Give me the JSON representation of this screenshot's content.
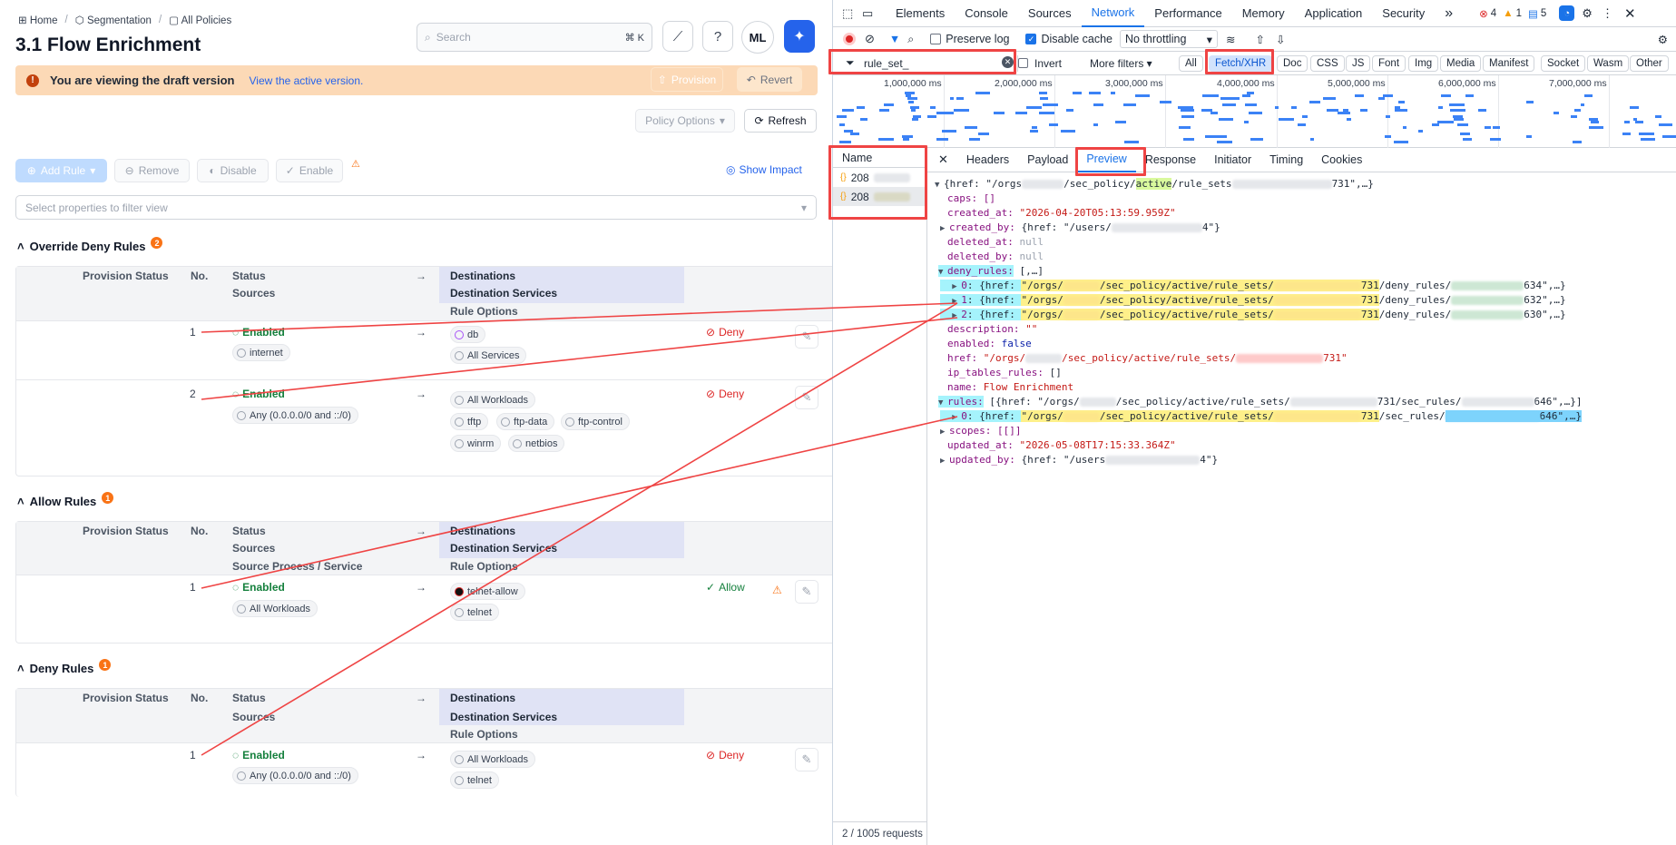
{
  "app": {
    "breadcrumb": {
      "home": "Home",
      "segmentation": "Segmentation",
      "all_policies": "All Policies"
    },
    "title": "3.1 Flow Enrichment",
    "search": {
      "placeholder": "Search",
      "shortcut": "⌘ K"
    },
    "avatar": "ML",
    "banner": {
      "message": "You are viewing the draft version",
      "link": "View the active version."
    },
    "provision_label": "Provision",
    "revert_label": "Revert",
    "policy_options_label": "Policy Options",
    "refresh_label": "Refresh",
    "toolbar": {
      "add_rule": "Add Rule",
      "remove": "Remove",
      "disable": "Disable",
      "enable": "Enable",
      "show_impact": "Show Impact"
    },
    "filter_placeholder": "Select properties to filter view",
    "columns": {
      "provision_status": "Provision Status",
      "no": "No.",
      "status": "Status",
      "sources": "Sources",
      "source_process": "Source Process / Service",
      "destinations": "Destinations",
      "destination_services": "Destination Services",
      "rule_options": "Rule Options",
      "arrow": "→"
    },
    "sections": [
      {
        "title": "Override Deny Rules",
        "count": "2"
      },
      {
        "title": "Allow Rules",
        "count": "1"
      },
      {
        "title": "Deny Rules",
        "count": "1"
      }
    ],
    "override_rows": [
      {
        "no": "1",
        "status": "Enabled",
        "source": "internet",
        "destination": "db",
        "service": "All Services",
        "action": "Deny"
      },
      {
        "no": "2",
        "status": "Enabled",
        "source": "Any (0.0.0.0/0 and ::/0)",
        "destination": "All Workloads",
        "services": [
          "tftp",
          "ftp-data",
          "ftp-control",
          "winrm",
          "netbios"
        ],
        "action": "Deny"
      }
    ],
    "allow_rows": [
      {
        "no": "1",
        "status": "Enabled",
        "source": "All Workloads",
        "destination": "telnet-allow",
        "service": "telnet",
        "action": "Allow"
      }
    ],
    "deny_rows": [
      {
        "no": "1",
        "status": "Enabled",
        "source": "Any (0.0.0.0/0 and ::/0)",
        "destination": "All Workloads",
        "service": "telnet",
        "action": "Deny"
      }
    ]
  },
  "devtools": {
    "tabs": [
      "Elements",
      "Console",
      "Sources",
      "Network",
      "Performance",
      "Memory",
      "Application",
      "Security"
    ],
    "active_tab": "Network",
    "more_tabs": "»",
    "errors": "4",
    "warnings": "1",
    "messages": "5",
    "toolbar": {
      "preserve_log": "Preserve log",
      "disable_cache": "Disable cache",
      "throttling": "No throttling"
    },
    "filter": {
      "value": "rule_set_",
      "invert": "Invert",
      "more_filters": "More filters"
    },
    "type_filters": [
      "All",
      "Fetch/XHR",
      "Doc",
      "CSS",
      "JS",
      "Font",
      "Img",
      "Media",
      "Manifest",
      "Socket",
      "Wasm",
      "Other"
    ],
    "active_type": "Fetch/XHR",
    "timeline_ticks": [
      "1,000,000 ms",
      "2,000,000 ms",
      "3,000,000 ms",
      "4,000,000 ms",
      "5,000,000 ms",
      "6,000,000 ms",
      "7,000,000 ms"
    ],
    "name_header": "Name",
    "requests": [
      "208",
      "208"
    ],
    "status_bar": "2 / 1005 requests",
    "preview_tabs": [
      "Headers",
      "Payload",
      "Preview",
      "Response",
      "Initiator",
      "Timing",
      "Cookies"
    ],
    "active_preview_tab": "Preview",
    "json": {
      "root_open": "{href: \"/orgs",
      "root_mid": "/sec_policy/",
      "root_active": "active",
      "root_tail1": "/rule_sets",
      "root_tail2": "731\",…}",
      "caps": "caps: []",
      "created_at_key": "created_at: ",
      "created_at_val": "\"2026-04-20T05:13:59.959Z\"",
      "created_by_key": "created_by: ",
      "created_by_val_a": "{href: \"/users/",
      "created_by_val_b": "4\"}",
      "deleted_at_key": "deleted_at: ",
      "deleted_by_key": "deleted_by: ",
      "null": "null",
      "deny_rules_key": "deny_rules:",
      "deny_rules_val": " [,…]",
      "deny_items": [
        {
          "idx": "0",
          "tail": "634\",…}"
        },
        {
          "idx": "1",
          "tail": "632\",…}"
        },
        {
          "idx": "2",
          "tail": "630\",…}"
        }
      ],
      "href_key": ": {href: ",
      "href_orgs": "\"/orgs/",
      "href_path": "/sec_policy/active/rule_sets/",
      "href_731": "731",
      "href_deny": "/deny_rules/",
      "description_key": "description: ",
      "description_val": "\"\"",
      "enabled_key": "enabled: ",
      "enabled_val": "false",
      "href_line_key": "href: ",
      "href_line_a": "\"/orgs/",
      "href_line_b": "/sec_policy/active/rule_sets/",
      "href_line_c": "731\"",
      "ip_tables_key": "ip_tables_rules: ",
      "ip_tables_val": "[]",
      "name_key": "name: ",
      "name_val": "Flow Enrichment",
      "rules_key": "rules:",
      "rules_val_a": " [{href: \"/orgs/",
      "rules_val_b": "/sec_policy/active/rule_sets/",
      "rules_val_c": "731/sec_rules/",
      "rules_val_d": "646\",…}]",
      "rules_item_idx": "0",
      "rules_item_c": "731",
      "rules_item_d": "/sec_rules/",
      "rules_item_e": "646\",…}",
      "scopes": "scopes: [[]]",
      "updated_at_key": "updated_at: ",
      "updated_at_val": "\"2026-05-08T17:15:33.364Z\"",
      "updated_by_key": "updated_by: ",
      "updated_by_val_a": "{href: \"/users",
      "updated_by_val_b": "4\"}"
    }
  },
  "annotation_color": "#ef4444"
}
